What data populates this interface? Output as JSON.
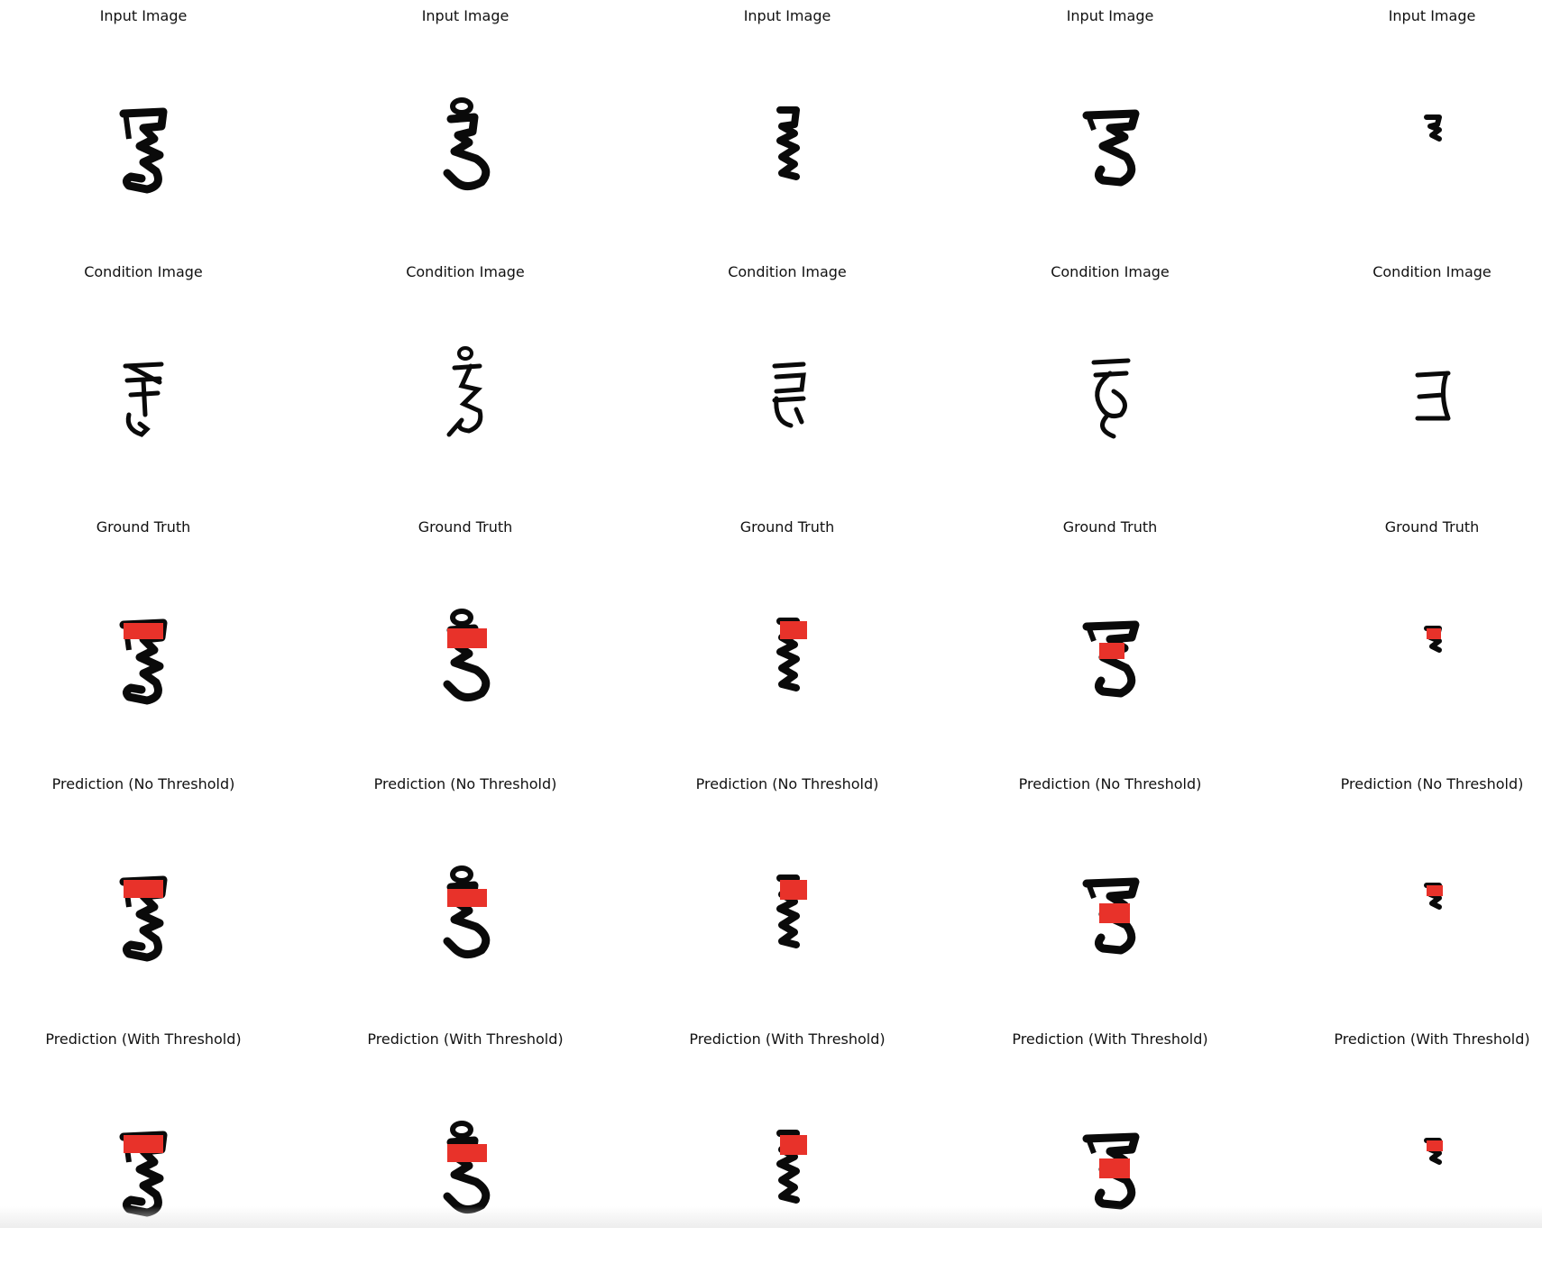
{
  "figure": {
    "row_titles": [
      "Input Image",
      "Condition Image",
      "Ground Truth",
      "Prediction (No Threshold)",
      "Prediction (With Threshold)"
    ],
    "columns": 5,
    "colors": {
      "ink": "#0a0a0a",
      "highlight": "#e8322a",
      "background": "#ffffff"
    }
  }
}
